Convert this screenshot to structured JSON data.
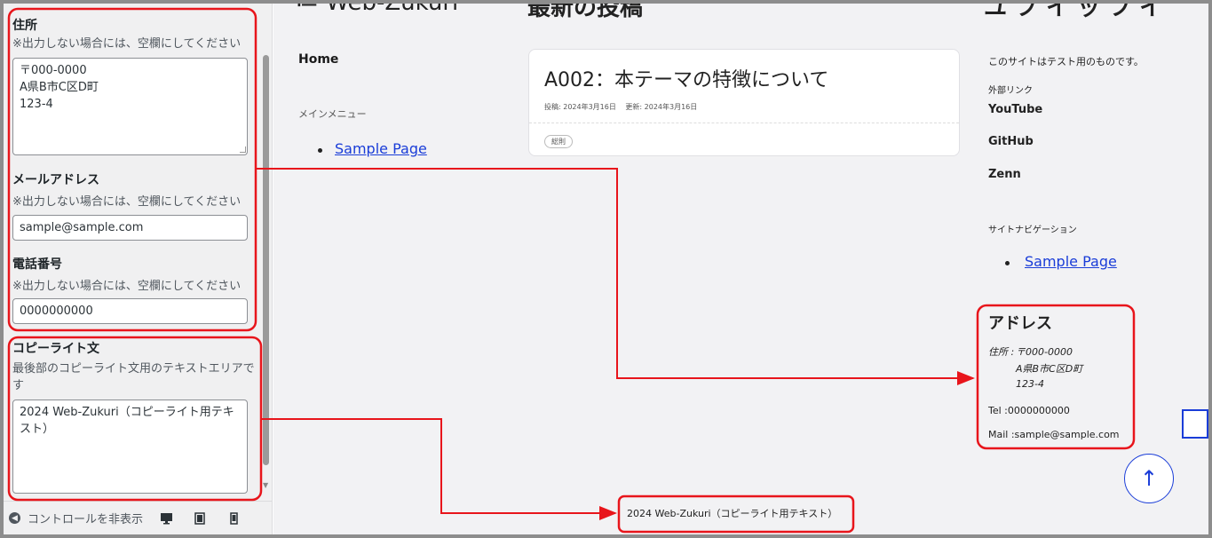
{
  "panel": {
    "address": {
      "title": "住所",
      "desc": "※出力しない場合には、空欄にしてください",
      "value": "〒000-0000\nA県B市C区D町\n123-4"
    },
    "email": {
      "title": "メールアドレス",
      "desc": "※出力しない場合には、空欄にしてください",
      "value": "sample@sample.com"
    },
    "phone": {
      "title": "電話番号",
      "desc": "※出力しない場合には、空欄にしてください",
      "value": "0000000000"
    },
    "copyright": {
      "title": "コピーライト文",
      "desc": "最後部のコピーライト文用のテキストエリアです",
      "value": "2024 Web-Zukuri（コピーライト用テキスト）"
    },
    "footer": {
      "collapse_label": "コントロールを非表示"
    }
  },
  "preview": {
    "site_title": "≔ Web-Zukuri",
    "section_title": "最新の投稿",
    "right_title": "ユ  フ イ ッ フ イ",
    "nav": {
      "home": "Home",
      "menu_label": "メインメニュー",
      "menu_items": [
        "Sample Page"
      ]
    },
    "post": {
      "title": "A002：本テーマの特徴について",
      "meta": "投稿: 2024年3月16日　 更新: 2024年3月16日",
      "tag": "総則"
    },
    "sidebar": {
      "intro": "このサイトはテスト用のものです。",
      "links_label": "外部リンク",
      "links": [
        "YouTube",
        "GitHub",
        "Zenn"
      ],
      "nav_label": "サイトナビゲーション",
      "nav_items": [
        "Sample Page"
      ]
    },
    "address_block": {
      "heading": "アドレス",
      "address_prefix": "住所 :",
      "address_lines": [
        "〒000-0000",
        "A県B市C区D町",
        "123-4"
      ],
      "tel": "Tel :0000000000",
      "mail": "Mail :sample@sample.com"
    },
    "back_to_top": "↑",
    "copyright": "2024 Web-Zukuri（コピーライト用テキスト）"
  },
  "colors": {
    "annotation": "#e8151b",
    "link": "#1a3dd8"
  }
}
